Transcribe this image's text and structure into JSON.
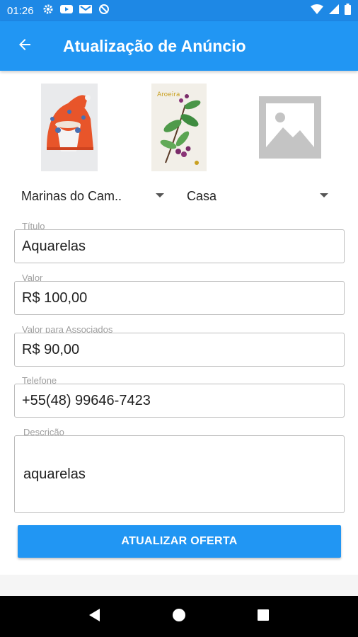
{
  "status_bar": {
    "time": "01:26",
    "icons": [
      "gear-icon",
      "youtube-icon",
      "gmail-icon",
      "no-sync-icon",
      "wifi-icon",
      "signal-icon",
      "battery-icon"
    ]
  },
  "app_bar": {
    "title": "Atualização de Anúncio",
    "back_icon": "arrow-left-icon"
  },
  "images": [
    {
      "name": "santa-painting-photo"
    },
    {
      "name": "flower-painting-photo"
    },
    {
      "name": "image-placeholder-icon"
    }
  ],
  "spinners": {
    "location": "Marinas do Cam..",
    "category": "Casa"
  },
  "form": {
    "title_label": "Título",
    "title_value": "Aquarelas",
    "price_label": "Valor",
    "price_value": "R$ 100,00",
    "member_price_label": "Valor para Associados",
    "member_price_value": "R$ 90,00",
    "phone_label": "Telefone",
    "phone_value": "+55(48) 99646-7423",
    "description_label": "Descrição",
    "description_value": "aquarelas"
  },
  "submit_label": "ATUALIZAR OFERTA",
  "nav": [
    "back-triangle-icon",
    "home-circle-icon",
    "recents-square-icon"
  ],
  "colors": {
    "primary": "#2196f3",
    "primary_dark": "#1e88e5"
  }
}
